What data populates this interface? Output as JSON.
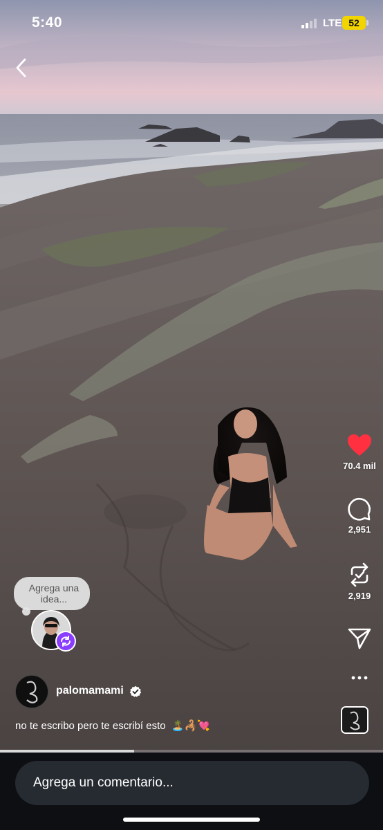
{
  "status": {
    "time": "5:40",
    "network": "LTE",
    "battery": "52"
  },
  "actions": {
    "likes": "70.4 mil",
    "comments": "2,951",
    "reposts": "2,919"
  },
  "idea": {
    "text": "Agrega una idea..."
  },
  "post": {
    "author": "palomamami",
    "caption": "no te escribo pero te escribí esto",
    "caption_emojis": "🏝️🦂💘"
  },
  "comment": {
    "placeholder": "Agrega un comentario..."
  },
  "progress": {
    "played_fraction": 0.35
  },
  "colors": {
    "like": "#ff3040",
    "repost_badge": "#8b3dff",
    "battery": "#f2d400"
  },
  "icons": [
    "back-icon",
    "heart-icon",
    "comment-icon",
    "repost-icon",
    "share-icon",
    "more-icon",
    "verified-icon"
  ]
}
